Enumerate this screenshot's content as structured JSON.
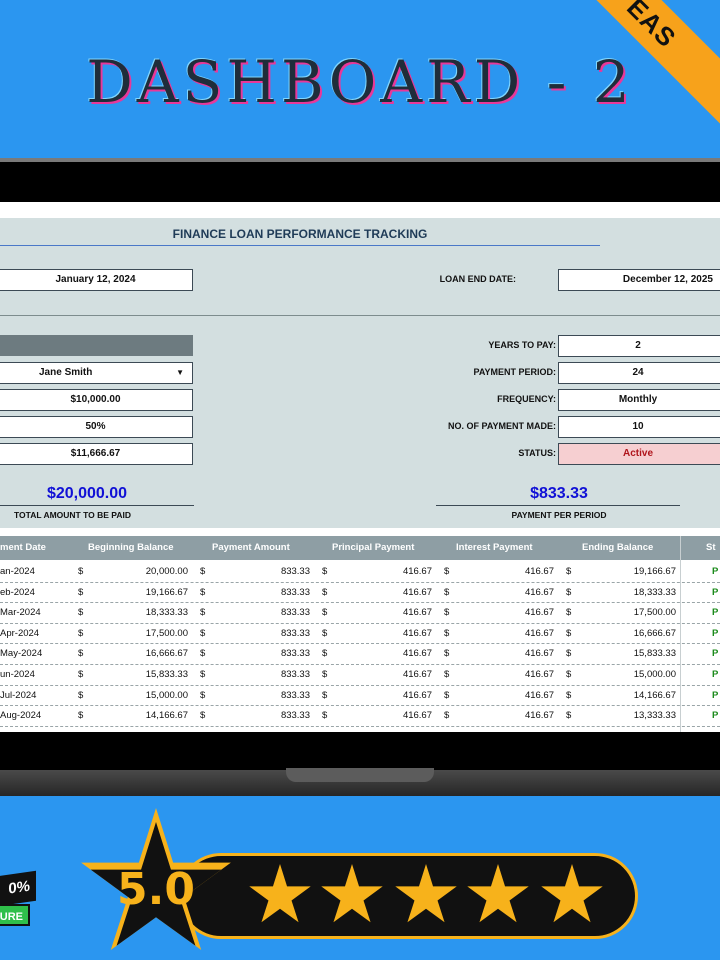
{
  "banner": {
    "title": "DASHBOARD - 2",
    "ribbon": "EAS"
  },
  "dashboard": {
    "title": "FINANCE LOAN PERFORMANCE TRACKING",
    "start_date": "January 12, 2024",
    "end_date_label": "LOAN END DATE:",
    "end_date": "December 12, 2025",
    "borrower": "Jane Smith",
    "loan_amount": "$10,000.00",
    "interest_rate": "50%",
    "third_value": "$11,666.67",
    "years_label": "YEARS TO PAY:",
    "years": "2",
    "period_label": "PAYMENT PERIOD:",
    "period": "24",
    "frequency_label": "FREQUENCY:",
    "frequency": "Monthly",
    "payments_made_label": "NO. OF PAYMENT MADE:",
    "payments_made": "10",
    "status_label": "STATUS:",
    "status": "Active",
    "total_amount": "$20,000.00",
    "total_caption": "TOTAL AMOUNT TO BE PAID",
    "per_period": "$833.33",
    "per_period_caption": "PAYMENT PER PERIOD"
  },
  "table": {
    "headers": [
      "ment Date",
      "Beginning Balance",
      "Payment Amount",
      "Principal Payment",
      "Interest Payment",
      "Ending Balance",
      "St"
    ],
    "currency": "$",
    "status_fragment": "P",
    "rows": [
      {
        "date": "an-2024",
        "begin": "20,000.00",
        "payment": "833.33",
        "principal": "416.67",
        "interest": "416.67",
        "end": "19,166.67"
      },
      {
        "date": "eb-2024",
        "begin": "19,166.67",
        "payment": "833.33",
        "principal": "416.67",
        "interest": "416.67",
        "end": "18,333.33"
      },
      {
        "date": "Mar-2024",
        "begin": "18,333.33",
        "payment": "833.33",
        "principal": "416.67",
        "interest": "416.67",
        "end": "17,500.00"
      },
      {
        "date": "Apr-2024",
        "begin": "17,500.00",
        "payment": "833.33",
        "principal": "416.67",
        "interest": "416.67",
        "end": "16,666.67"
      },
      {
        "date": "May-2024",
        "begin": "16,666.67",
        "payment": "833.33",
        "principal": "416.67",
        "interest": "416.67",
        "end": "15,833.33"
      },
      {
        "date": "un-2024",
        "begin": "15,833.33",
        "payment": "833.33",
        "principal": "416.67",
        "interest": "416.67",
        "end": "15,000.00"
      },
      {
        "date": "Jul-2024",
        "begin": "15,000.00",
        "payment": "833.33",
        "principal": "416.67",
        "interest": "416.67",
        "end": "14,166.67"
      },
      {
        "date": "Aug-2024",
        "begin": "14,166.67",
        "payment": "833.33",
        "principal": "416.67",
        "interest": "416.67",
        "end": "13,333.33"
      }
    ]
  },
  "rating": {
    "score": "5.0",
    "stars": 5,
    "badge_top": "0%",
    "badge_bottom": "URE",
    "accent": "#f7b21b"
  }
}
